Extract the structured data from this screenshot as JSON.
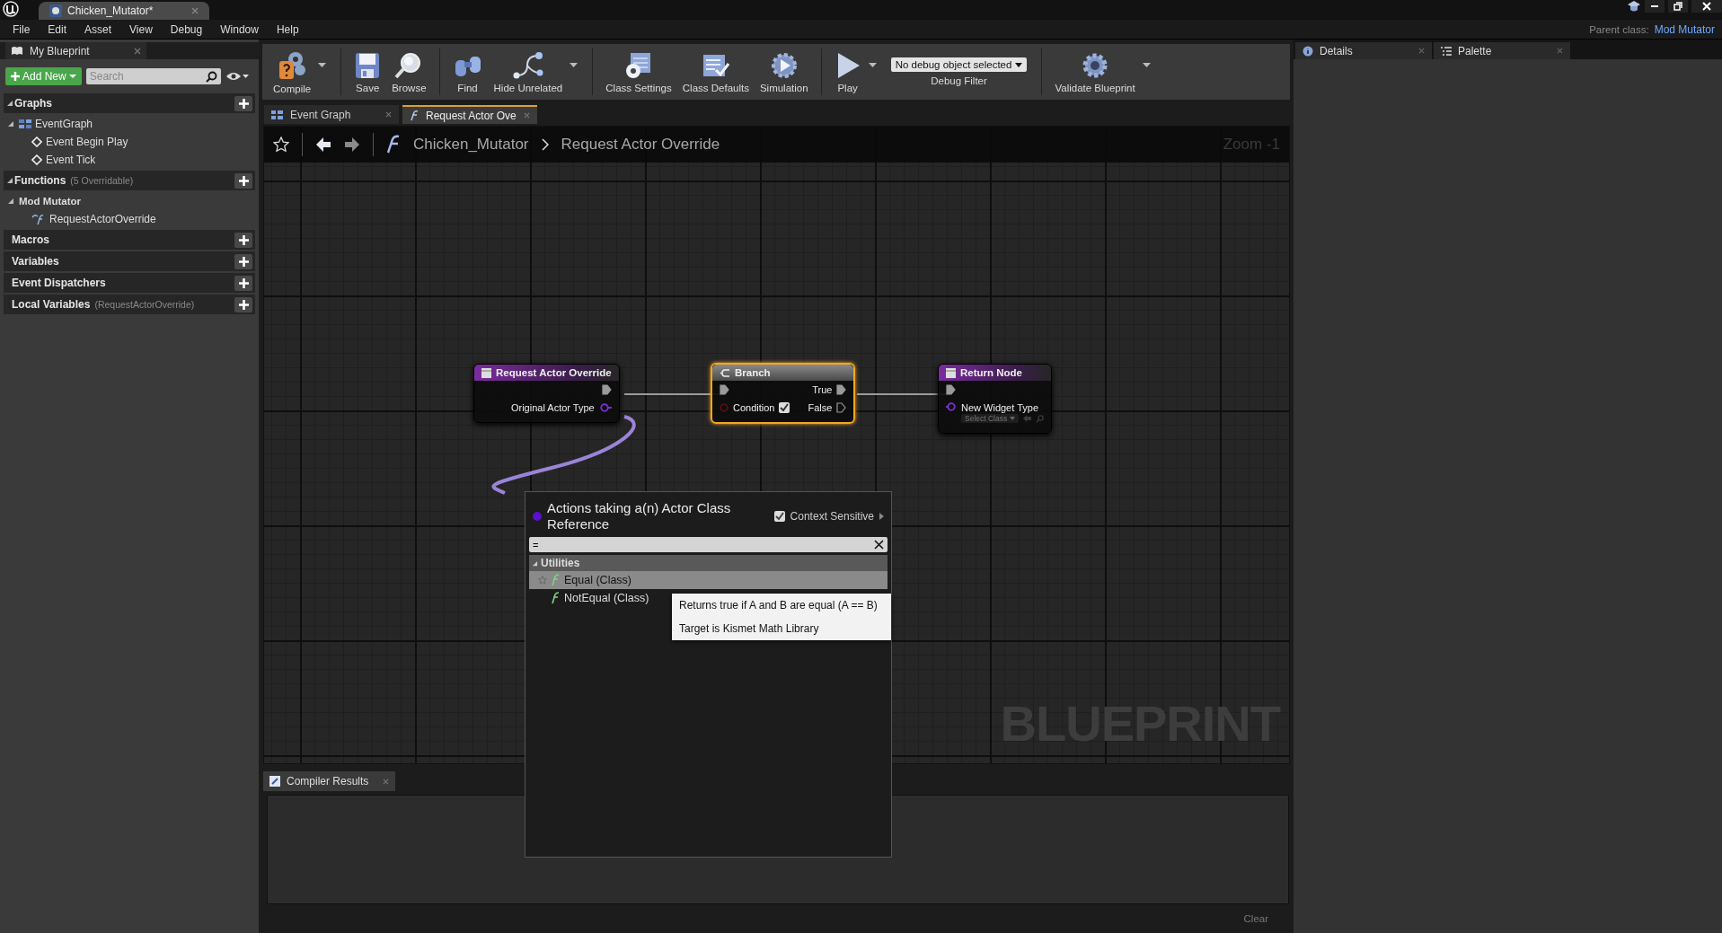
{
  "title_bar": {
    "tab": "Chicken_Mutator*"
  },
  "menu": [
    "File",
    "Edit",
    "Asset",
    "View",
    "Debug",
    "Window",
    "Help"
  ],
  "parent_class": {
    "label": "Parent class:",
    "value": "Mod Mutator"
  },
  "my_blueprint": {
    "tab": "My Blueprint",
    "add_new": "Add New",
    "search_placeholder": "Search",
    "sections": [
      {
        "title": "Graphs",
        "expanded": true,
        "children": [
          {
            "label": "EventGraph",
            "kind": "graph",
            "expanded": true,
            "children": [
              {
                "label": "Event Begin Play",
                "kind": "event"
              },
              {
                "label": "Event Tick",
                "kind": "event"
              }
            ]
          }
        ]
      },
      {
        "title": "Functions",
        "note": "(5 Overridable)",
        "expanded": true,
        "children": [
          {
            "label": "Mod Mutator",
            "kind": "category",
            "expanded": true,
            "children": [
              {
                "label": "RequestActorOverride",
                "kind": "function"
              }
            ]
          }
        ]
      },
      {
        "title": "Macros"
      },
      {
        "title": "Variables"
      },
      {
        "title": "Event Dispatchers"
      },
      {
        "title": "Local Variables",
        "note": "(RequestActorOverride)"
      }
    ]
  },
  "toolbar": [
    [
      {
        "kind": "button",
        "label": "Compile",
        "dropdown": true
      }
    ],
    [
      {
        "kind": "button",
        "label": "Save",
        "dropdown": false
      },
      {
        "kind": "button",
        "label": "Browse",
        "dropdown": false
      }
    ],
    [
      {
        "kind": "button",
        "label": "Find",
        "dropdown": false
      },
      {
        "kind": "button",
        "label": "Hide Unrelated",
        "dropdown": true
      }
    ],
    [
      {
        "kind": "button",
        "label": "Class Settings",
        "dropdown": false
      },
      {
        "kind": "button",
        "label": "Class Defaults",
        "dropdown": false
      },
      {
        "kind": "button",
        "label": "Simulation",
        "dropdown": false
      }
    ],
    [
      {
        "kind": "button",
        "label": "Play",
        "dropdown": true
      },
      {
        "kind": "debug_filter",
        "value": "No debug object selected",
        "label": "Debug Filter"
      }
    ],
    [
      {
        "kind": "button",
        "label": "Validate Blueprint",
        "dropdown": true
      }
    ]
  ],
  "doc_tabs": [
    {
      "label": "Event Graph",
      "kind": "graph",
      "selected": false
    },
    {
      "label": "Request Actor Ove",
      "kind": "function",
      "selected": true
    }
  ],
  "breadcrumb": {
    "path": [
      "Chicken_Mutator",
      "Request Actor Override"
    ],
    "zoom": "Zoom -1"
  },
  "nodes": [
    {
      "kind": "entry",
      "title": "Request Actor Override",
      "selected": false,
      "pin": "Original Actor Type"
    },
    {
      "kind": "branch",
      "title": "Branch",
      "selected": true,
      "condition": "Condition",
      "checked": true,
      "true_label": "True",
      "false_label": "False"
    },
    {
      "kind": "return",
      "title": "Return Node",
      "selected": false,
      "pin": "New Widget Type",
      "picker": "Select Class"
    }
  ],
  "watermark": "BLUEPRINT",
  "action_menu": {
    "title": "Actions taking a(n) Actor Class Reference",
    "context_sensitive": {
      "label": "Context Sensitive",
      "checked": true
    },
    "search": "=",
    "categories": [
      {
        "label": "Utilities",
        "expanded": true,
        "items": [
          {
            "label": "Equal (Class)",
            "selected": true
          },
          {
            "label": "NotEqual (Class)",
            "selected": false
          }
        ]
      }
    ],
    "tooltip": [
      "Returns true if A and B are equal (A == B)",
      "Target is Kismet Math Library"
    ]
  },
  "compiler_results": {
    "tab": "Compiler Results",
    "clear": "Clear"
  },
  "right_tabs": [
    {
      "label": "Details",
      "kind": "details"
    },
    {
      "label": "Palette",
      "kind": "palette"
    }
  ]
}
